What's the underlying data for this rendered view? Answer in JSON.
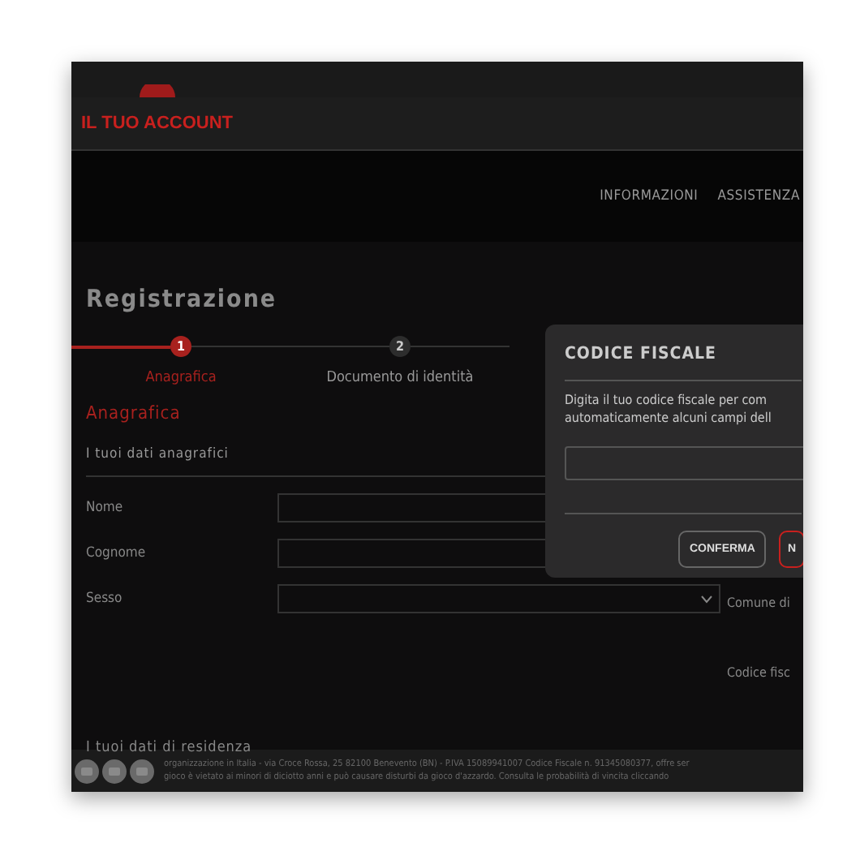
{
  "header": {
    "title": "IL TUO ACCOUNT"
  },
  "nav": [
    "INFORMAZIONI",
    "ASSISTENZA"
  ],
  "page_title": "Registrazione",
  "steps": [
    {
      "number": "1",
      "label": "Anagrafica",
      "selected": true
    },
    {
      "number": "2",
      "label": "Documento di identità",
      "selected": false
    }
  ],
  "section_title": "Anagrafica",
  "group_title": "I tuoi dati anagrafici",
  "fields": [
    {
      "label": "Nome",
      "kind": "text"
    },
    {
      "label": "Cognome",
      "kind": "text"
    },
    {
      "label": "Sesso",
      "kind": "select"
    }
  ],
  "side_labels": [
    "Comune di",
    "Codice fisc"
  ],
  "residence_title": "I tuoi dati di residenza",
  "footer_lines": [
    "organizzazione in Italia - via Croce Rossa, 25 82100 Benevento (BN) - P.IVA 15089941007 Codice Fiscale n. 91345080377, offre ser",
    "gioco è vietato ai minori di diciotto anni e può causare disturbi da gioco d'azzardo. Consulta le probabilità di vincita cliccando"
  ],
  "modal": {
    "title": "CODICE FISCALE",
    "text": "Digita il tuo codice fiscale per com automaticamente alcuni campi dell",
    "buttons": [
      {
        "label": "CONFERMA",
        "kind": "secondary"
      },
      {
        "label": "N",
        "kind": "primary"
      }
    ]
  }
}
